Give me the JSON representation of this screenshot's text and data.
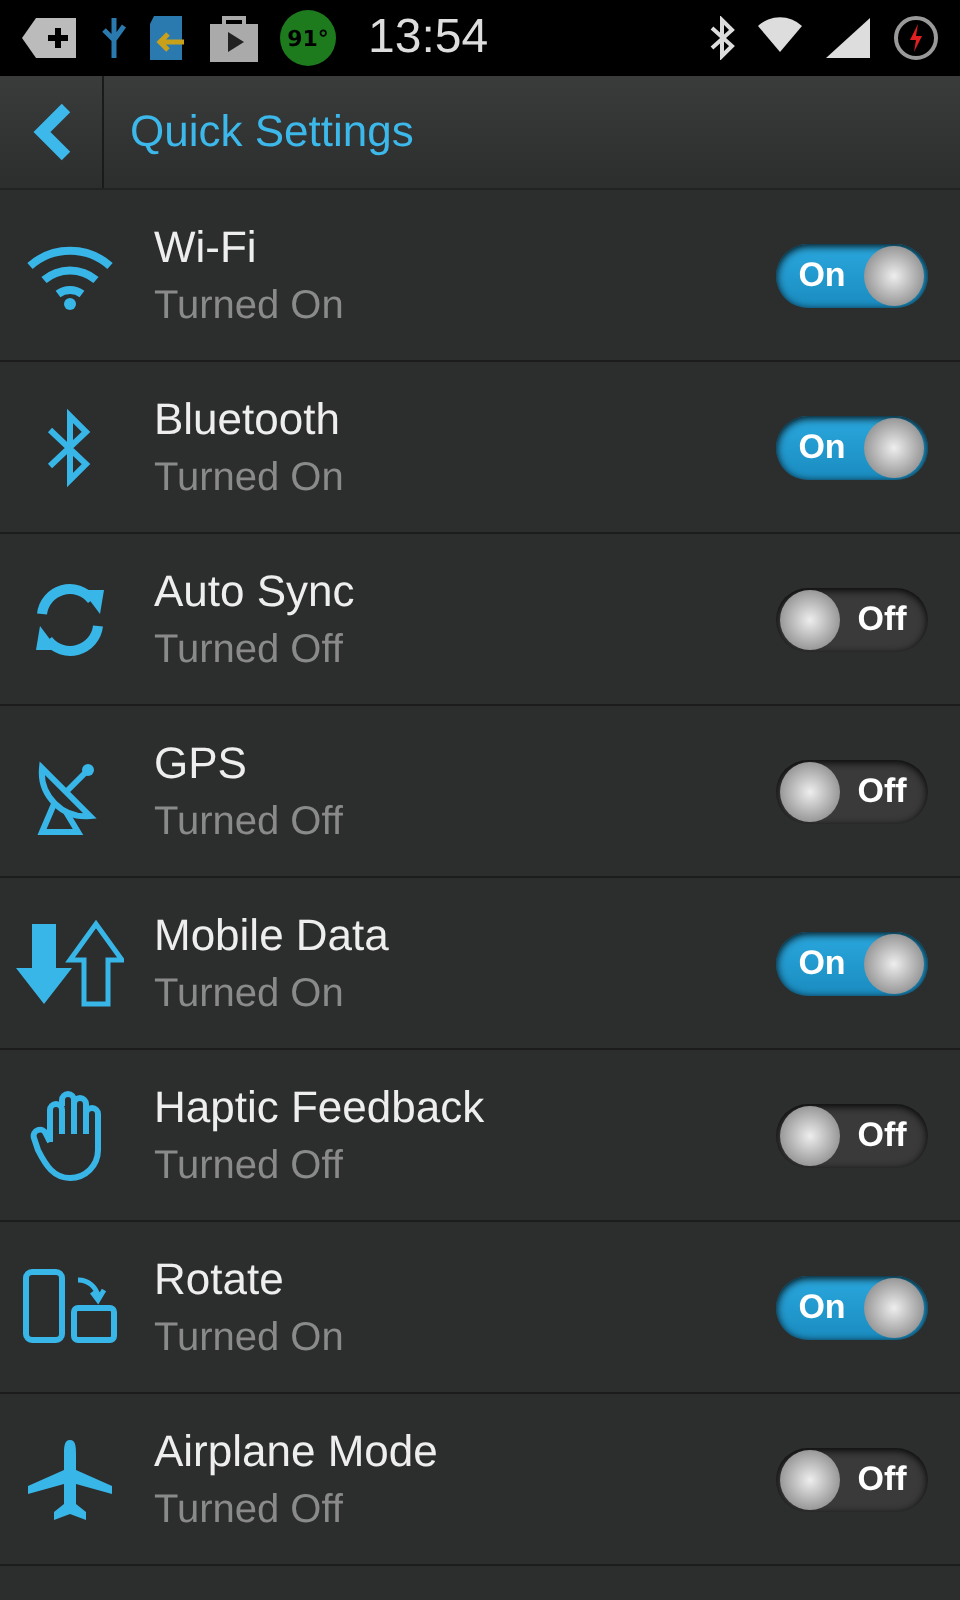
{
  "status_bar": {
    "battery_badge": "91°",
    "time": "13:54"
  },
  "header": {
    "title": "Quick Settings"
  },
  "settings": [
    {
      "kind": "wifi",
      "name": "Wi-Fi",
      "status": "Turned On",
      "on": true,
      "toggle_label": "On"
    },
    {
      "kind": "bluetooth",
      "name": "Bluetooth",
      "status": "Turned On",
      "on": true,
      "toggle_label": "On"
    },
    {
      "kind": "sync",
      "name": "Auto Sync",
      "status": "Turned Off",
      "on": false,
      "toggle_label": "Off"
    },
    {
      "kind": "gps",
      "name": "GPS",
      "status": "Turned Off",
      "on": false,
      "toggle_label": "Off"
    },
    {
      "kind": "data",
      "name": "Mobile Data",
      "status": "Turned On",
      "on": true,
      "toggle_label": "On"
    },
    {
      "kind": "haptic",
      "name": "Haptic Feedback",
      "status": "Turned Off",
      "on": false,
      "toggle_label": "Off"
    },
    {
      "kind": "rotate",
      "name": "Rotate",
      "status": "Turned On",
      "on": true,
      "toggle_label": "On"
    },
    {
      "kind": "airplane",
      "name": "Airplane Mode",
      "status": "Turned Off",
      "on": false,
      "toggle_label": "Off"
    }
  ]
}
